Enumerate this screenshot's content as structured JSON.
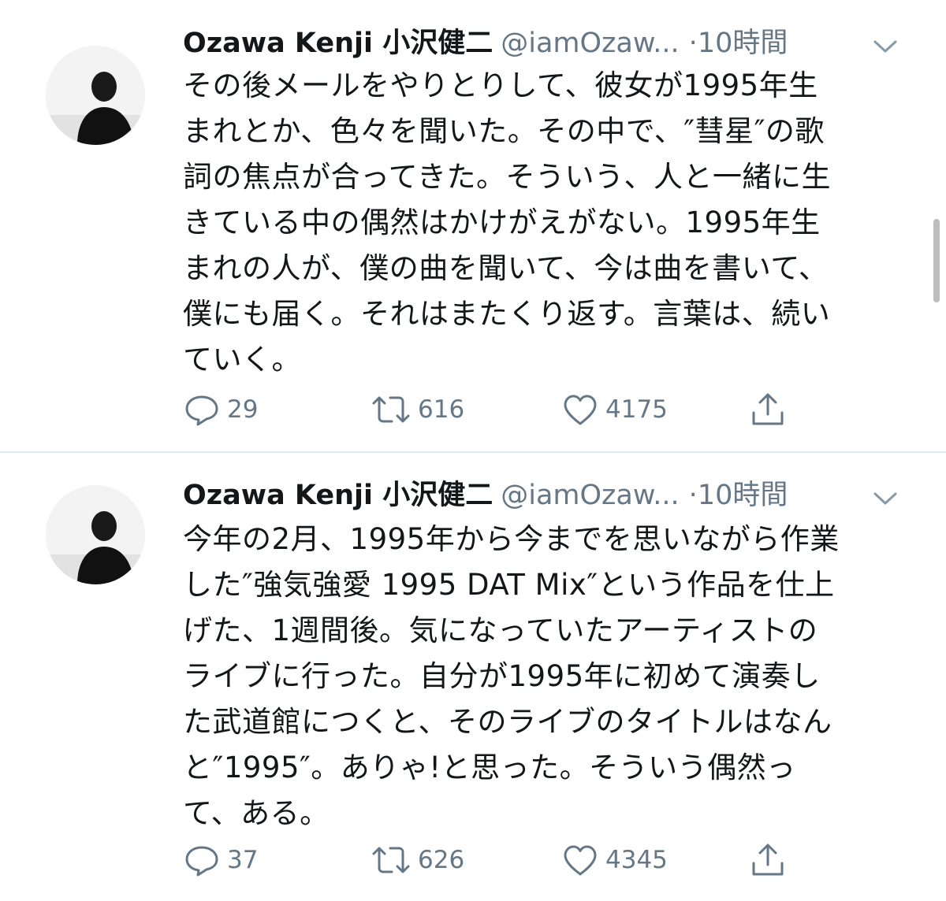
{
  "tweets": [
    {
      "display_name": "Ozawa Kenji 小沢健二",
      "handle": "@iamOzaw...",
      "separator": "·",
      "time": "10時間",
      "avatar_icon": "avatar-photo",
      "lines": [
        "その後メールをやりとりして、彼女が1995年生",
        "まれとか、色々を聞いた。その中で、″彗星″の歌",
        "詞の焦点が合ってきた。そういう、人と一緒に生",
        "きている中の偶然はかけがえがない。1995年生",
        "まれの人が、僕の曲を聞いて、今は曲を書いて、",
        "僕にも届く。それはまたくり返す。言葉は、続い",
        "ていく。"
      ],
      "actions": {
        "reply_count": "29",
        "retweet_count": "616",
        "like_count": "4175"
      }
    },
    {
      "display_name": "Ozawa Kenji 小沢健二",
      "handle": "@iamOzaw...",
      "separator": "·",
      "time": "10時間",
      "avatar_icon": "avatar-photo",
      "lines": [
        "今年の2月、1995年から今までを思いながら作業",
        "した″強気強愛 1995 DAT Mix″という作品を仕上",
        "げた、1週間後。気になっていたアーティストの",
        "ライブに行った。自分が1995年に初めて演奏し",
        "た武道館につくと、そのライブのタイトルはなん",
        "と″1995″。ありゃ!と思った。そういう偶然っ",
        "て、ある。"
      ],
      "actions": {
        "reply_count": "37",
        "retweet_count": "626",
        "like_count": "4345"
      }
    }
  ],
  "colors": {
    "text": "#14171a",
    "secondary": "#657786",
    "divider": "#e1e8ed"
  }
}
